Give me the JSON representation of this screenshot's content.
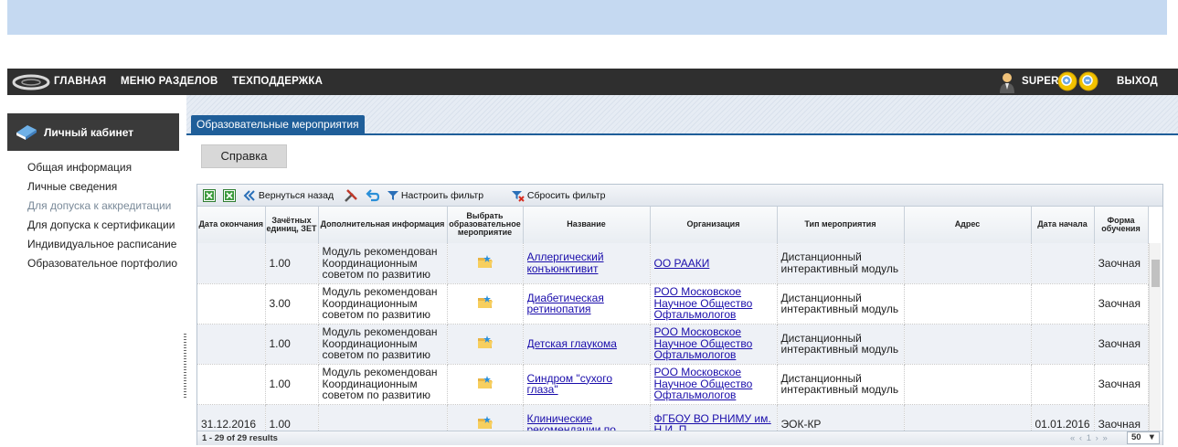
{
  "nav": {
    "home": "ГЛАВНАЯ",
    "sections": "МЕНЮ РАЗДЕЛОВ",
    "support": "ТЕХПОДДЕРЖКА",
    "user": "SUPER",
    "logout": "ВЫХОД"
  },
  "sidebar": {
    "title": "Личный кабинет",
    "items": [
      {
        "label": "Общая информация"
      },
      {
        "label": "Личные сведения"
      },
      {
        "label": "Для допуска к аккредитации"
      },
      {
        "label": "Для допуска к сертификации"
      },
      {
        "label": "Индивидуальное расписание"
      },
      {
        "label": "Образовательное портфолио"
      }
    ]
  },
  "tab": {
    "label": "Образовательные мероприятия"
  },
  "help_button": "Справка",
  "toolbar": {
    "back": "Вернуться назад",
    "filter": "Настроить фильтр",
    "reset": "Сбросить фильтр"
  },
  "columns": [
    "Дата окончания",
    "Зачётных единиц, ЗЕТ",
    "Дополнительная информация",
    "Выбрать образовательное мероприятие",
    "Название",
    "Организация",
    "Тип мероприятия",
    "Адрес",
    "Дата начала",
    "Форма обучения"
  ],
  "rows": [
    {
      "end": "",
      "zet": "1.00",
      "info": "Модуль рекомендован Координационным советом по развитию",
      "name": "Аллергический конъюнктивит",
      "org": "ОО РААКИ",
      "type": "Дистанционный интерактивный модуль",
      "address": "",
      "start": "",
      "form": "Заочная"
    },
    {
      "end": "",
      "zet": "3.00",
      "info": "Модуль рекомендован Координационным советом по развитию",
      "name": "Диабетическая ретинопатия",
      "org": "РОО Московское Научное Общество Офтальмологов",
      "type": "Дистанционный интерактивный модуль",
      "address": "",
      "start": "",
      "form": "Заочная"
    },
    {
      "end": "",
      "zet": "1.00",
      "info": "Модуль рекомендован Координационным советом по развитию",
      "name": "Детская глаукома",
      "org": "РОО Московское Научное Общество Офтальмологов",
      "type": "Дистанционный интерактивный модуль",
      "address": "",
      "start": "",
      "form": "Заочная"
    },
    {
      "end": "",
      "zet": "1.00",
      "info": "Модуль рекомендован Координационным советом по развитию",
      "name": "Синдром \"сухого глаза\"",
      "org": "РОО Московское Научное Общество Офтальмологов",
      "type": "Дистанционный интерактивный модуль",
      "address": "",
      "start": "",
      "form": "Заочная"
    },
    {
      "end": "31.12.2016",
      "zet": "1.00",
      "info": "",
      "name": "Клинические рекомендации по",
      "org": "ФГБОУ ВО РНИМУ им. Н.И. П",
      "type": "ЭОК-КР",
      "address": "",
      "start": "01.01.2016",
      "form": "Заочная"
    }
  ],
  "footer": {
    "results": "1 - 29 of 29 results",
    "pager": "« ‹ 1 › »",
    "page_size": "50"
  }
}
